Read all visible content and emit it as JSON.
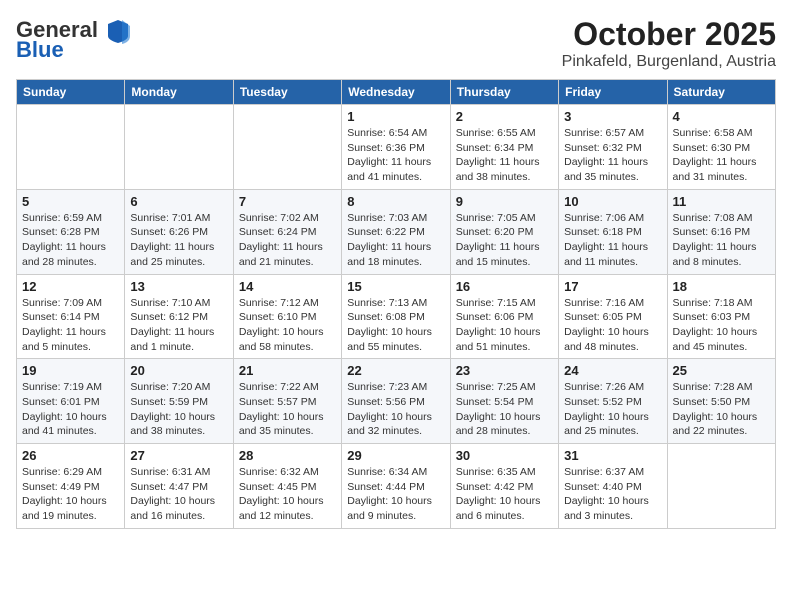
{
  "header": {
    "logo_general": "General",
    "logo_blue": "Blue",
    "month": "October 2025",
    "location": "Pinkafeld, Burgenland, Austria"
  },
  "weekdays": [
    "Sunday",
    "Monday",
    "Tuesday",
    "Wednesday",
    "Thursday",
    "Friday",
    "Saturday"
  ],
  "weeks": [
    [
      {
        "day": "",
        "info": ""
      },
      {
        "day": "",
        "info": ""
      },
      {
        "day": "",
        "info": ""
      },
      {
        "day": "1",
        "info": "Sunrise: 6:54 AM\nSunset: 6:36 PM\nDaylight: 11 hours\nand 41 minutes."
      },
      {
        "day": "2",
        "info": "Sunrise: 6:55 AM\nSunset: 6:34 PM\nDaylight: 11 hours\nand 38 minutes."
      },
      {
        "day": "3",
        "info": "Sunrise: 6:57 AM\nSunset: 6:32 PM\nDaylight: 11 hours\nand 35 minutes."
      },
      {
        "day": "4",
        "info": "Sunrise: 6:58 AM\nSunset: 6:30 PM\nDaylight: 11 hours\nand 31 minutes."
      }
    ],
    [
      {
        "day": "5",
        "info": "Sunrise: 6:59 AM\nSunset: 6:28 PM\nDaylight: 11 hours\nand 28 minutes."
      },
      {
        "day": "6",
        "info": "Sunrise: 7:01 AM\nSunset: 6:26 PM\nDaylight: 11 hours\nand 25 minutes."
      },
      {
        "day": "7",
        "info": "Sunrise: 7:02 AM\nSunset: 6:24 PM\nDaylight: 11 hours\nand 21 minutes."
      },
      {
        "day": "8",
        "info": "Sunrise: 7:03 AM\nSunset: 6:22 PM\nDaylight: 11 hours\nand 18 minutes."
      },
      {
        "day": "9",
        "info": "Sunrise: 7:05 AM\nSunset: 6:20 PM\nDaylight: 11 hours\nand 15 minutes."
      },
      {
        "day": "10",
        "info": "Sunrise: 7:06 AM\nSunset: 6:18 PM\nDaylight: 11 hours\nand 11 minutes."
      },
      {
        "day": "11",
        "info": "Sunrise: 7:08 AM\nSunset: 6:16 PM\nDaylight: 11 hours\nand 8 minutes."
      }
    ],
    [
      {
        "day": "12",
        "info": "Sunrise: 7:09 AM\nSunset: 6:14 PM\nDaylight: 11 hours\nand 5 minutes."
      },
      {
        "day": "13",
        "info": "Sunrise: 7:10 AM\nSunset: 6:12 PM\nDaylight: 11 hours\nand 1 minute."
      },
      {
        "day": "14",
        "info": "Sunrise: 7:12 AM\nSunset: 6:10 PM\nDaylight: 10 hours\nand 58 minutes."
      },
      {
        "day": "15",
        "info": "Sunrise: 7:13 AM\nSunset: 6:08 PM\nDaylight: 10 hours\nand 55 minutes."
      },
      {
        "day": "16",
        "info": "Sunrise: 7:15 AM\nSunset: 6:06 PM\nDaylight: 10 hours\nand 51 minutes."
      },
      {
        "day": "17",
        "info": "Sunrise: 7:16 AM\nSunset: 6:05 PM\nDaylight: 10 hours\nand 48 minutes."
      },
      {
        "day": "18",
        "info": "Sunrise: 7:18 AM\nSunset: 6:03 PM\nDaylight: 10 hours\nand 45 minutes."
      }
    ],
    [
      {
        "day": "19",
        "info": "Sunrise: 7:19 AM\nSunset: 6:01 PM\nDaylight: 10 hours\nand 41 minutes."
      },
      {
        "day": "20",
        "info": "Sunrise: 7:20 AM\nSunset: 5:59 PM\nDaylight: 10 hours\nand 38 minutes."
      },
      {
        "day": "21",
        "info": "Sunrise: 7:22 AM\nSunset: 5:57 PM\nDaylight: 10 hours\nand 35 minutes."
      },
      {
        "day": "22",
        "info": "Sunrise: 7:23 AM\nSunset: 5:56 PM\nDaylight: 10 hours\nand 32 minutes."
      },
      {
        "day": "23",
        "info": "Sunrise: 7:25 AM\nSunset: 5:54 PM\nDaylight: 10 hours\nand 28 minutes."
      },
      {
        "day": "24",
        "info": "Sunrise: 7:26 AM\nSunset: 5:52 PM\nDaylight: 10 hours\nand 25 minutes."
      },
      {
        "day": "25",
        "info": "Sunrise: 7:28 AM\nSunset: 5:50 PM\nDaylight: 10 hours\nand 22 minutes."
      }
    ],
    [
      {
        "day": "26",
        "info": "Sunrise: 6:29 AM\nSunset: 4:49 PM\nDaylight: 10 hours\nand 19 minutes."
      },
      {
        "day": "27",
        "info": "Sunrise: 6:31 AM\nSunset: 4:47 PM\nDaylight: 10 hours\nand 16 minutes."
      },
      {
        "day": "28",
        "info": "Sunrise: 6:32 AM\nSunset: 4:45 PM\nDaylight: 10 hours\nand 12 minutes."
      },
      {
        "day": "29",
        "info": "Sunrise: 6:34 AM\nSunset: 4:44 PM\nDaylight: 10 hours\nand 9 minutes."
      },
      {
        "day": "30",
        "info": "Sunrise: 6:35 AM\nSunset: 4:42 PM\nDaylight: 10 hours\nand 6 minutes."
      },
      {
        "day": "31",
        "info": "Sunrise: 6:37 AM\nSunset: 4:40 PM\nDaylight: 10 hours\nand 3 minutes."
      },
      {
        "day": "",
        "info": ""
      }
    ]
  ]
}
